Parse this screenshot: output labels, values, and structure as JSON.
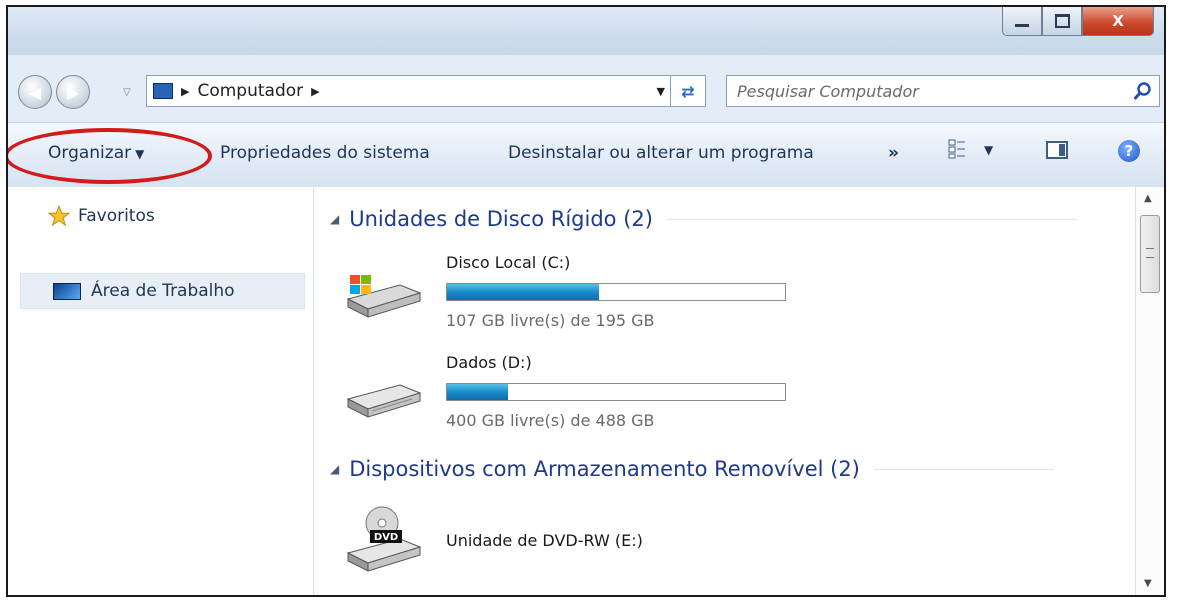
{
  "window": {
    "buttons": {
      "minimize": "minimize",
      "maximize": "maximize",
      "close": "X"
    }
  },
  "address": {
    "location": "Computador",
    "search_placeholder": "Pesquisar Computador"
  },
  "toolbar": {
    "organize_label": "Organizar",
    "system_properties_label": "Propriedades do sistema",
    "uninstall_label": "Desinstalar ou alterar um programa",
    "more_label": "»"
  },
  "navigation": {
    "favorites_label": "Favoritos",
    "desktop_label": "Área de Trabalho"
  },
  "groups": {
    "hard_drives": {
      "title": "Unidades de Disco Rígido (2)",
      "drives": [
        {
          "name": "Disco Local (C:)",
          "free_text": "107 GB livre(s) de 195 GB",
          "used_fraction": 0.45
        },
        {
          "name": "Dados (D:)",
          "free_text": "400 GB livre(s) de 488 GB",
          "used_fraction": 0.18
        }
      ]
    },
    "removable": {
      "title": "Dispositivos com Armazenamento Removível (2)",
      "devices": [
        {
          "name": "Unidade de DVD-RW (E:)",
          "badge": "DVD"
        }
      ]
    }
  },
  "colors": {
    "highlight_circle": "#d21c1c",
    "group_title": "#1e3a8a",
    "usage_bar": "#1a8ccc"
  }
}
